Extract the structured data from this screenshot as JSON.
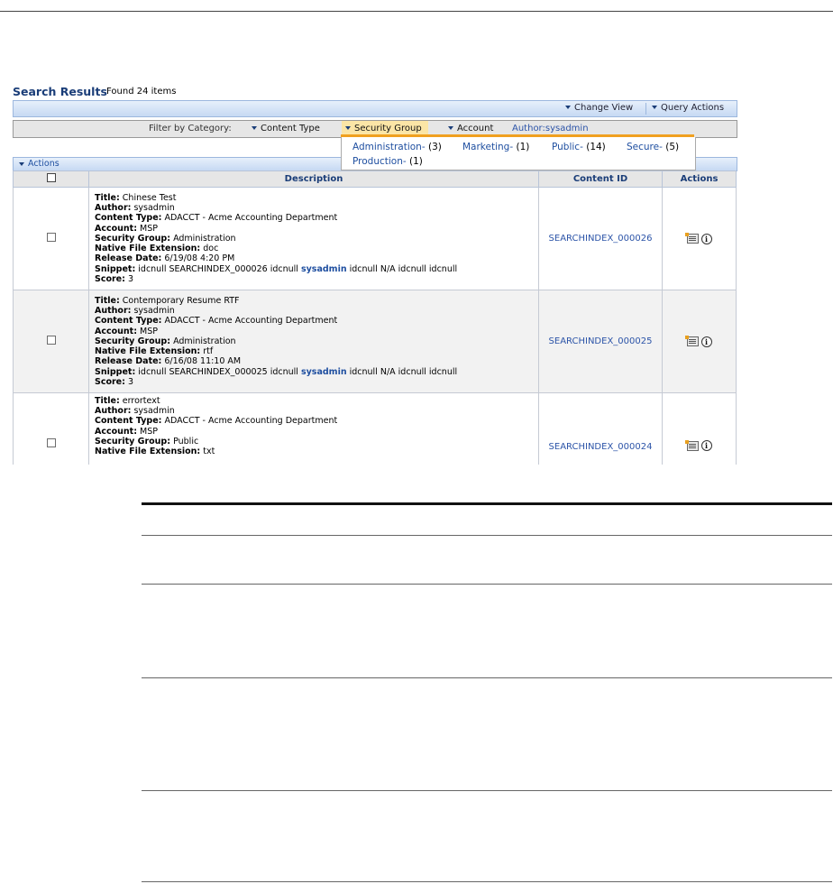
{
  "header": {
    "title": "Search Results",
    "found": "Found 24 items"
  },
  "toolbar": {
    "change_view": "Change View",
    "query_actions": "Query Actions"
  },
  "filter": {
    "label": "Filter by Category:",
    "categories": [
      "Content Type",
      "Security Group",
      "Account"
    ],
    "author": "Author:sysadmin"
  },
  "dropdown": {
    "items": [
      {
        "label": "Administration-",
        "count": "(3)"
      },
      {
        "label": "Marketing-",
        "count": "(1)"
      },
      {
        "label": "Public-",
        "count": "(14)"
      },
      {
        "label": "Secure-",
        "count": "(5)"
      },
      {
        "label": "Production-",
        "count": "(1)"
      }
    ]
  },
  "actions_bar": {
    "label": "Actions"
  },
  "table": {
    "columns": [
      "Description",
      "Content ID",
      "Actions"
    ],
    "rows": [
      {
        "fields": [
          [
            "Title:",
            " Chinese Test"
          ],
          [
            "Author:",
            " sysadmin"
          ],
          [
            "Content Type:",
            " ADACCT - Acme Accounting Department"
          ],
          [
            "Account:",
            " MSP"
          ],
          [
            "Security Group:",
            " Administration"
          ],
          [
            "Native File Extension:",
            " doc"
          ],
          [
            "Release Date:",
            " 6/19/08 4:20 PM"
          ]
        ],
        "snippet_label": "Snippet:",
        "snippet_a": " idcnull SEARCHINDEX_000026 idcnull ",
        "snippet_kw": "sysadmin",
        "snippet_b": " idcnull N/A idcnull idcnull",
        "score_label": "Score:",
        "score": " 3",
        "content_id": "SEARCHINDEX_000026"
      },
      {
        "fields": [
          [
            "Title:",
            " Contemporary Resume RTF"
          ],
          [
            "Author:",
            " sysadmin"
          ],
          [
            "Content Type:",
            " ADACCT - Acme Accounting Department"
          ],
          [
            "Account:",
            " MSP"
          ],
          [
            "Security Group:",
            " Administration"
          ],
          [
            "Native File Extension:",
            " rtf"
          ],
          [
            "Release Date:",
            " 6/16/08 11:10 AM"
          ]
        ],
        "snippet_label": "Snippet:",
        "snippet_a": " idcnull SEARCHINDEX_000025 idcnull ",
        "snippet_kw": "sysadmin",
        "snippet_b": " idcnull N/A idcnull idcnull",
        "score_label": "Score:",
        "score": " 3",
        "content_id": "SEARCHINDEX_000025"
      },
      {
        "fields": [
          [
            "Title:",
            " errortext"
          ],
          [
            "Author:",
            " sysadmin"
          ],
          [
            "Content Type:",
            " ADACCT - Acme Accounting Department"
          ],
          [
            "Account:",
            " MSP"
          ],
          [
            "Security Group:",
            " Public"
          ],
          [
            "Native File Extension:",
            " txt"
          ]
        ],
        "content_id": "SEARCHINDEX_000024"
      }
    ]
  },
  "icons": {
    "doc": "document-icon",
    "info": "info-icon",
    "caret": "caret-down-icon"
  }
}
